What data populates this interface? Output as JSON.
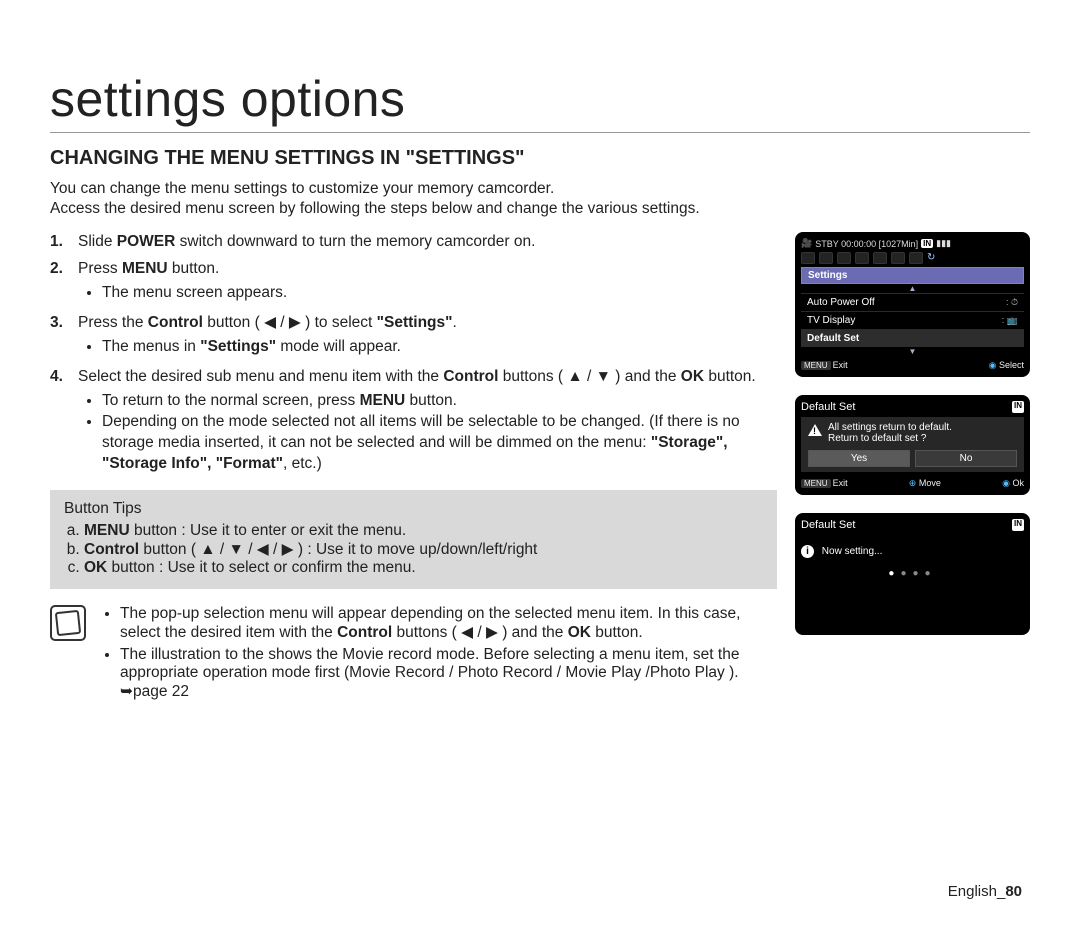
{
  "page_title": "settings options",
  "section_heading": "CHANGING THE MENU SETTINGS IN \"SETTINGS\"",
  "intro": [
    "You can change the menu settings to customize your memory camcorder.",
    "Access the desired menu screen by following the steps below and change the various settings."
  ],
  "steps": [
    {
      "num": "1.",
      "html": "Slide <b>POWER</b> switch downward to turn the memory camcorder on."
    },
    {
      "num": "2.",
      "html": "Press <b>MENU</b> button.",
      "bullets": [
        "The menu screen appears."
      ]
    },
    {
      "num": "3.",
      "html": "Press the <b>Control</b> button ( ◀ / ▶ ) to select <b>\"Settings\"</b>.",
      "bullets": [
        "The menus in <b>\"Settings\"</b> mode will appear."
      ]
    },
    {
      "num": "4.",
      "html": "Select the desired sub menu and menu item with the <b>Control</b> buttons ( ▲ / ▼ ) and the <b>OK</b> button.",
      "bullets": [
        "To return to the normal screen, press <b>MENU</b> button.",
        "Depending on the mode selected not all items will be selectable to be changed. (If there is no storage media inserted, it can not be selected and will be dimmed on the menu: <b>\"Storage\", \"Storage Info\", \"Format\"</b>, etc.)"
      ]
    }
  ],
  "tips": {
    "title": "Button Tips",
    "items": [
      "<b>MENU</b> button : Use it to enter or exit the menu.",
      "<b>Control</b> button ( ▲ / ▼ / ◀ / ▶ ) : Use it to move up/down/left/right",
      "<b>OK</b> button : Use it to select or confirm the menu."
    ]
  },
  "note": [
    "The pop-up selection menu will appear depending on the selected menu item. In this case, select the desired item with the <b>Control</b> buttons ( ◀ / ▶ ) and the <b>OK</b> button.",
    "The illustration to the shows the Movie record mode.  Before selecting a menu item, set the appropriate operation mode first (Movie Record / Photo Record / Movie Play /Photo Play ). ➥page 22"
  ],
  "footer": {
    "lang": "English",
    "sep": "_",
    "page": "80"
  },
  "lcd1": {
    "status": "STBY 00:00:00 [1027Min]",
    "section": "Settings",
    "items": [
      {
        "label": "Auto Power Off",
        "ind": ": ⏱"
      },
      {
        "label": "TV Display",
        "ind": ": 📺"
      },
      {
        "label": "Default Set",
        "ind": ""
      }
    ],
    "bottom": {
      "left": "Exit",
      "left_tag": "MENU",
      "right": "Select"
    }
  },
  "lcd2": {
    "title": "Default Set",
    "msg1": "All settings return to default.",
    "msg2": "Return to default set ?",
    "yes": "Yes",
    "no": "No",
    "bottom": {
      "exit_tag": "MENU",
      "exit": "Exit",
      "move": "Move",
      "ok": "Ok"
    }
  },
  "lcd3": {
    "title": "Default Set",
    "msg": "Now setting..."
  }
}
